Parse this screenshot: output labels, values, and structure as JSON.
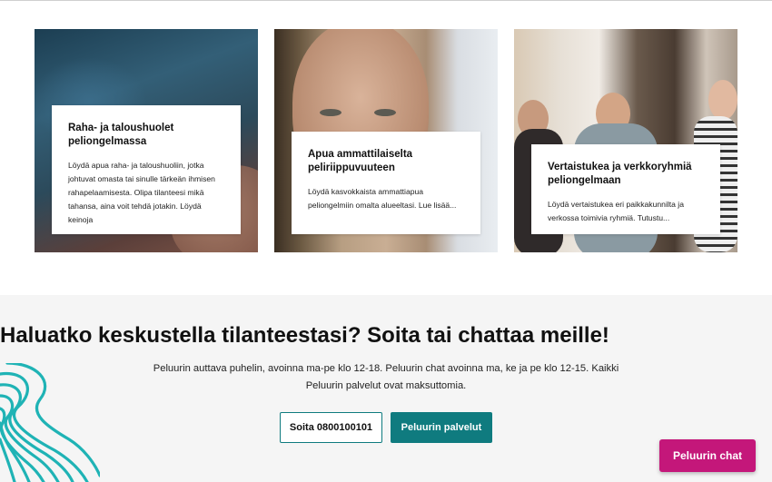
{
  "cards": [
    {
      "title": "Raha- ja taloushuolet peliongelmassa",
      "text": "Löydä apua raha- ja taloushuoliin, jotka johtuvat omasta tai sinulle tärkeän ihmisen rahapelaamisesta. Olipa tilanteesi mikä tahansa, aina voit tehdä jotakin. Löydä keinoja"
    },
    {
      "title": "Apua ammattilaiselta peliriippuvuuteen",
      "text": "Löydä kasvokkaista ammattiapua peliongelmiin omalta alueeltasi. Lue lisää..."
    },
    {
      "title": "Vertaistukea ja verkkoryhmiä peliongelmaan",
      "text": "Löydä vertaistukea eri paikkakunnilta ja verkossa toimivia ryhmiä. Tutustu..."
    }
  ],
  "contact": {
    "heading": "Haluatko keskustella tilanteestasi? Soita tai chattaa meille!",
    "text": "Peluurin auttava puhelin, avoinna ma-pe klo 12-18. Peluurin chat avoinna ma, ke ja pe klo 12-15. Kaikki Peluurin palvelut ovat maksuttomia.",
    "call_button": "Soita 0800100101",
    "services_button": "Peluurin palvelut"
  },
  "chat_button": "Peluurin chat",
  "colors": {
    "teal": "#0f7b7f",
    "magenta": "#c4177a",
    "band_bg": "#f5f5f5"
  }
}
